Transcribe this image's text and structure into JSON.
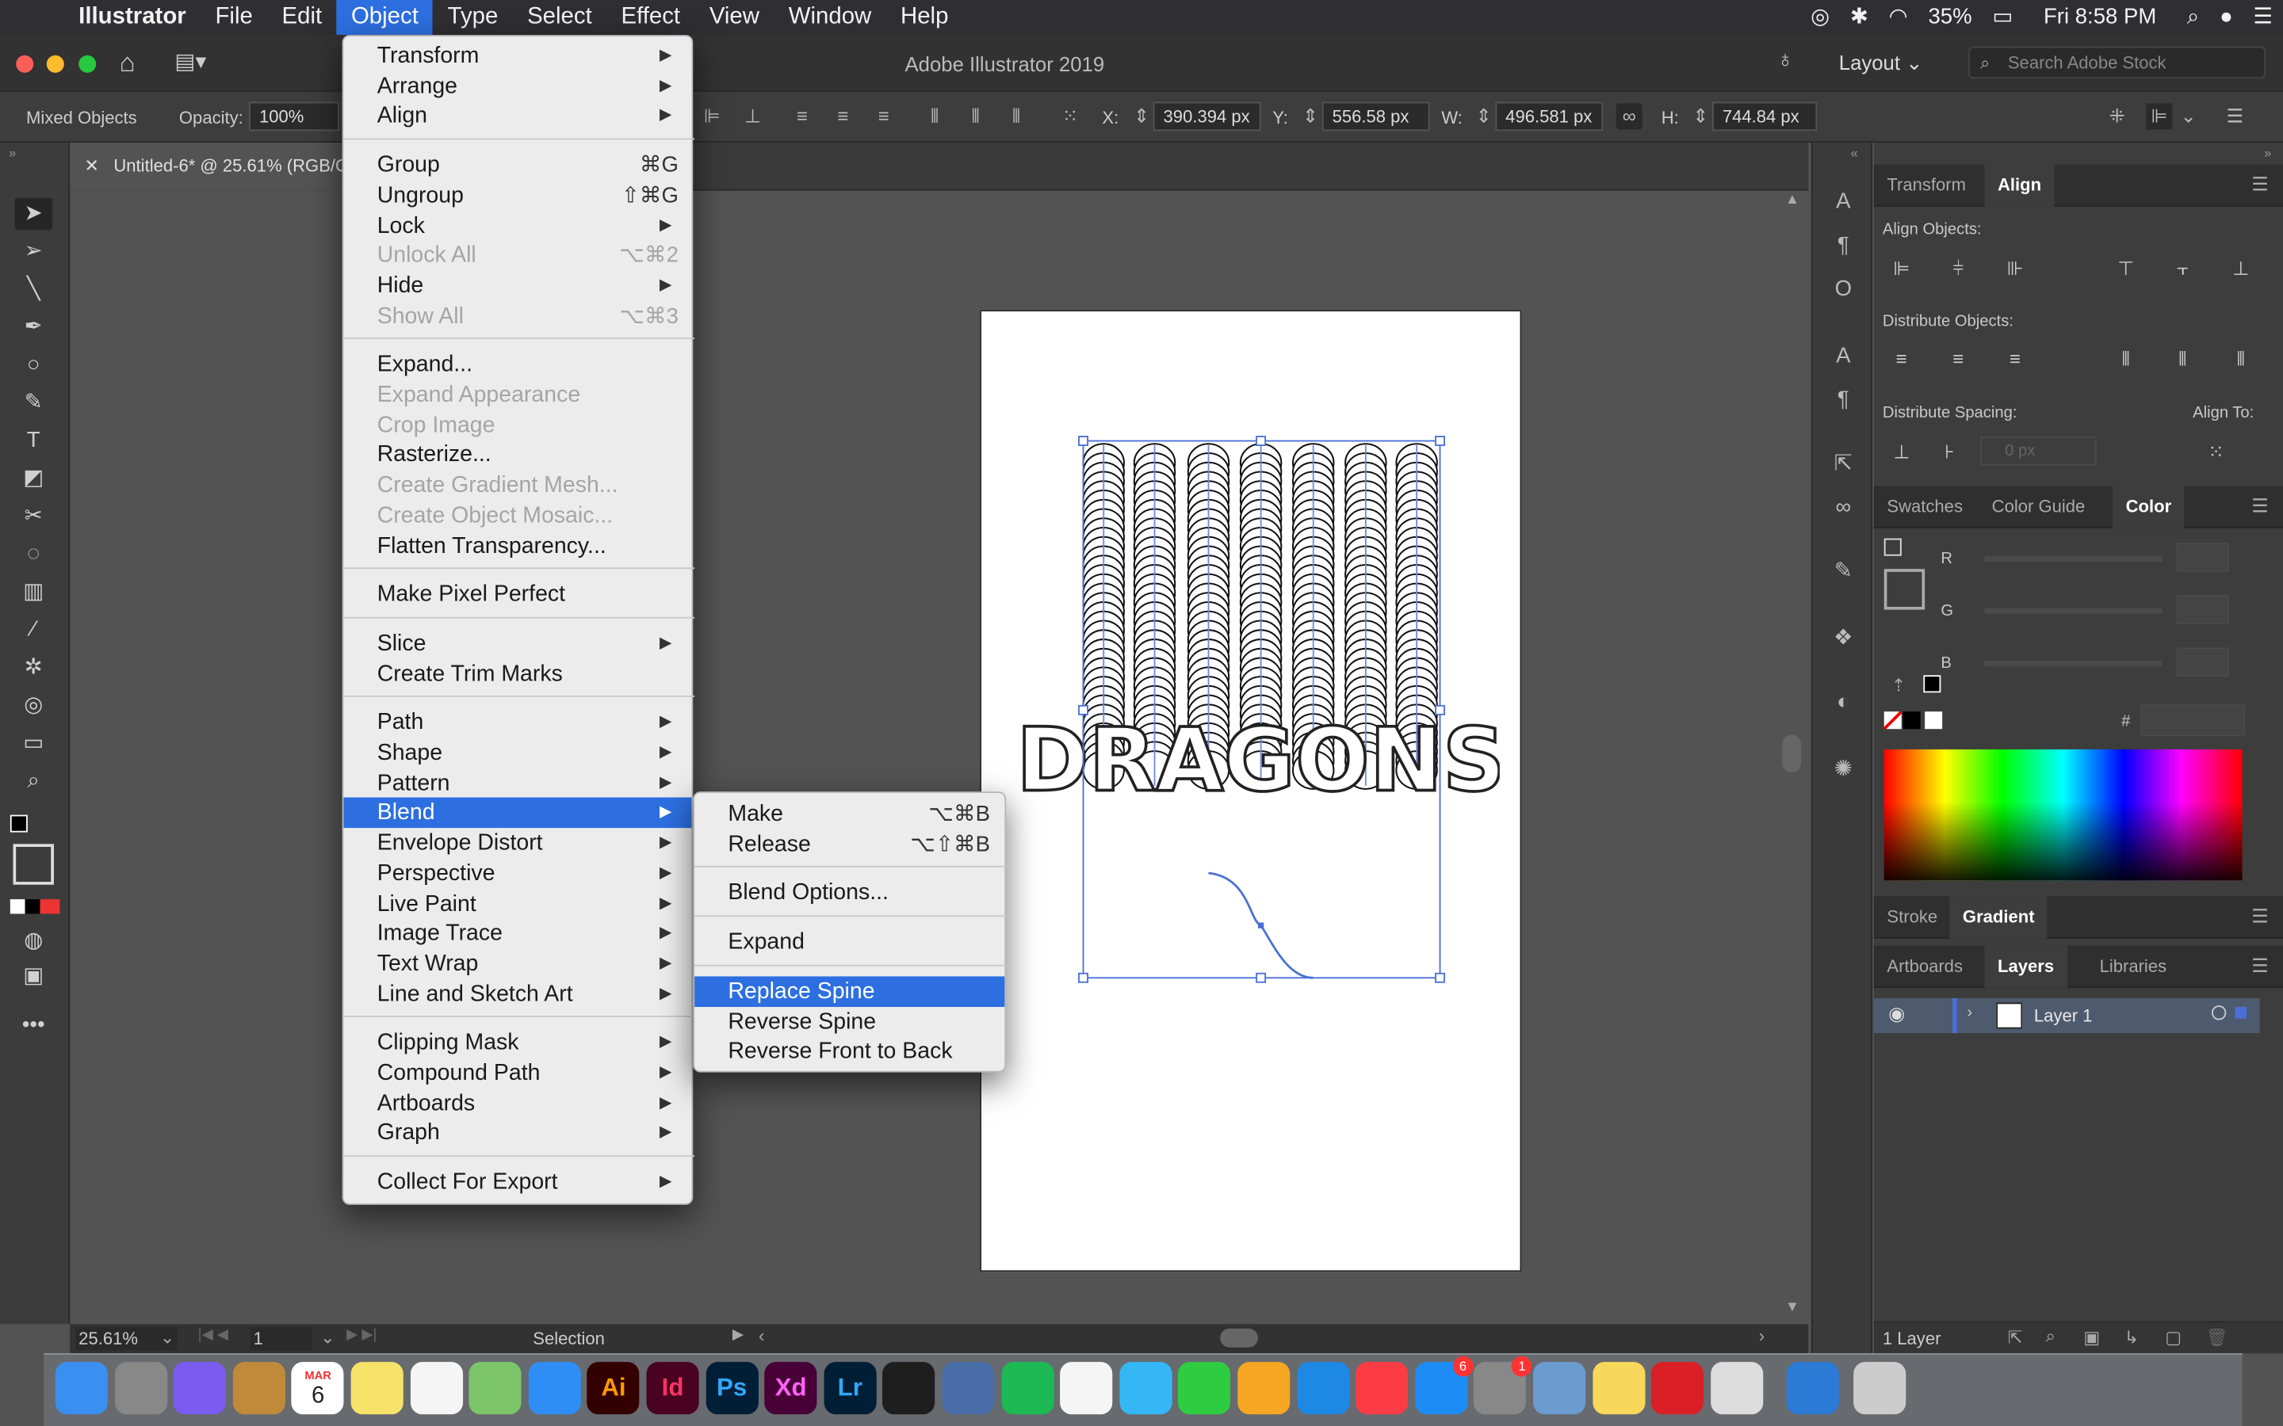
{
  "menubar": {
    "app": "Illustrator",
    "items": [
      "File",
      "Edit",
      "Object",
      "Type",
      "Select",
      "Effect",
      "View",
      "Window",
      "Help"
    ],
    "active": "Object",
    "battery": "35%",
    "clock": "Fri 8:58 PM"
  },
  "titlebar": {
    "title": "Adobe Illustrator 2019",
    "workspace": "Layout",
    "search_placeholder": "Search Adobe Stock"
  },
  "control": {
    "selection_type": "Mixed Objects",
    "opacity_label": "Opacity:",
    "opacity_value": "100%",
    "x_label": "X:",
    "x_value": "390.394 px",
    "y_label": "Y:",
    "y_value": "556.58 px",
    "w_label": "W:",
    "w_value": "496.581 px",
    "h_label": "H:",
    "h_value": "744.84 px"
  },
  "document": {
    "tab": "Untitled-6* @ 25.61% (RGB/C",
    "artwork_text": "DRAGONS"
  },
  "object_menu": {
    "rows": [
      {
        "label": "Transform",
        "arrow": true
      },
      {
        "label": "Arrange",
        "arrow": true
      },
      {
        "label": "Align",
        "arrow": true
      },
      {
        "sep": true
      },
      {
        "label": "Group",
        "shortcut": "⌘G"
      },
      {
        "label": "Ungroup",
        "shortcut": "⇧⌘G"
      },
      {
        "label": "Lock",
        "arrow": true
      },
      {
        "label": "Unlock All",
        "shortcut": "⌥⌘2",
        "disabled": true
      },
      {
        "label": "Hide",
        "arrow": true
      },
      {
        "label": "Show All",
        "shortcut": "⌥⌘3",
        "disabled": true
      },
      {
        "sep": true
      },
      {
        "label": "Expand..."
      },
      {
        "label": "Expand Appearance",
        "disabled": true
      },
      {
        "label": "Crop Image",
        "disabled": true
      },
      {
        "label": "Rasterize..."
      },
      {
        "label": "Create Gradient Mesh...",
        "disabled": true
      },
      {
        "label": "Create Object Mosaic...",
        "disabled": true
      },
      {
        "label": "Flatten Transparency..."
      },
      {
        "sep": true
      },
      {
        "label": "Make Pixel Perfect"
      },
      {
        "sep": true
      },
      {
        "label": "Slice",
        "arrow": true
      },
      {
        "label": "Create Trim Marks"
      },
      {
        "sep": true
      },
      {
        "label": "Path",
        "arrow": true
      },
      {
        "label": "Shape",
        "arrow": true
      },
      {
        "label": "Pattern",
        "arrow": true
      },
      {
        "label": "Blend",
        "arrow": true,
        "highlight": true
      },
      {
        "label": "Envelope Distort",
        "arrow": true
      },
      {
        "label": "Perspective",
        "arrow": true
      },
      {
        "label": "Live Paint",
        "arrow": true
      },
      {
        "label": "Image Trace",
        "arrow": true
      },
      {
        "label": "Text Wrap",
        "arrow": true
      },
      {
        "label": "Line and Sketch Art",
        "arrow": true
      },
      {
        "sep": true
      },
      {
        "label": "Clipping Mask",
        "arrow": true
      },
      {
        "label": "Compound Path",
        "arrow": true
      },
      {
        "label": "Artboards",
        "arrow": true
      },
      {
        "label": "Graph",
        "arrow": true
      },
      {
        "sep": true
      },
      {
        "label": "Collect For Export",
        "arrow": true
      }
    ]
  },
  "blend_menu": {
    "rows": [
      {
        "label": "Make",
        "shortcut": "⌥⌘B"
      },
      {
        "label": "Release",
        "shortcut": "⌥⇧⌘B"
      },
      {
        "sep": true
      },
      {
        "label": "Blend Options..."
      },
      {
        "sep": true
      },
      {
        "label": "Expand"
      },
      {
        "sep": true
      },
      {
        "label": "Replace Spine",
        "highlight": true
      },
      {
        "label": "Reverse Spine"
      },
      {
        "label": "Reverse Front to Back"
      }
    ]
  },
  "panels": {
    "top_tabs": [
      "Transform",
      "Align"
    ],
    "align_objects": "Align Objects:",
    "distribute_objects": "Distribute Objects:",
    "distribute_spacing": "Distribute Spacing:",
    "align_to": "Align To:",
    "spacing_value": "0 px",
    "color_tabs": [
      "Swatches",
      "Color Guide",
      "Color"
    ],
    "r": "R",
    "g": "G",
    "b": "B",
    "hash": "#",
    "stroke_tabs": [
      "Stroke",
      "Gradient"
    ],
    "layer_tabs": [
      "Artboards",
      "Layers",
      "Libraries"
    ],
    "layer_name": "Layer 1",
    "layer_count": "1 Layer"
  },
  "status": {
    "zoom": "25.61%",
    "artboard_num": "1",
    "tool_name": "Selection"
  },
  "dock": {
    "apps": [
      "Finder",
      "Launchpad",
      "Siri",
      "Notefile",
      "Calendar",
      "Notes",
      "Reminders",
      "Maps",
      "Safari",
      "Ai",
      "Id",
      "Ps",
      "Xd",
      "Lr",
      "Figma",
      "Kindle",
      "Spotify",
      "Photos",
      "Messages",
      "FaceTime",
      "Pages",
      "Keynote",
      "Music",
      "App Store",
      "System Preferences",
      "Preview",
      "Stickies",
      "Creative Cloud",
      "Printer",
      "Downloads",
      "Trash"
    ],
    "calendar_month": "MAR",
    "calendar_day": "6",
    "appstore_badge": "6",
    "prefs_badge": "1"
  },
  "colors": {
    "accent": "#2d6fe0",
    "selection": "#4a6fd8"
  }
}
